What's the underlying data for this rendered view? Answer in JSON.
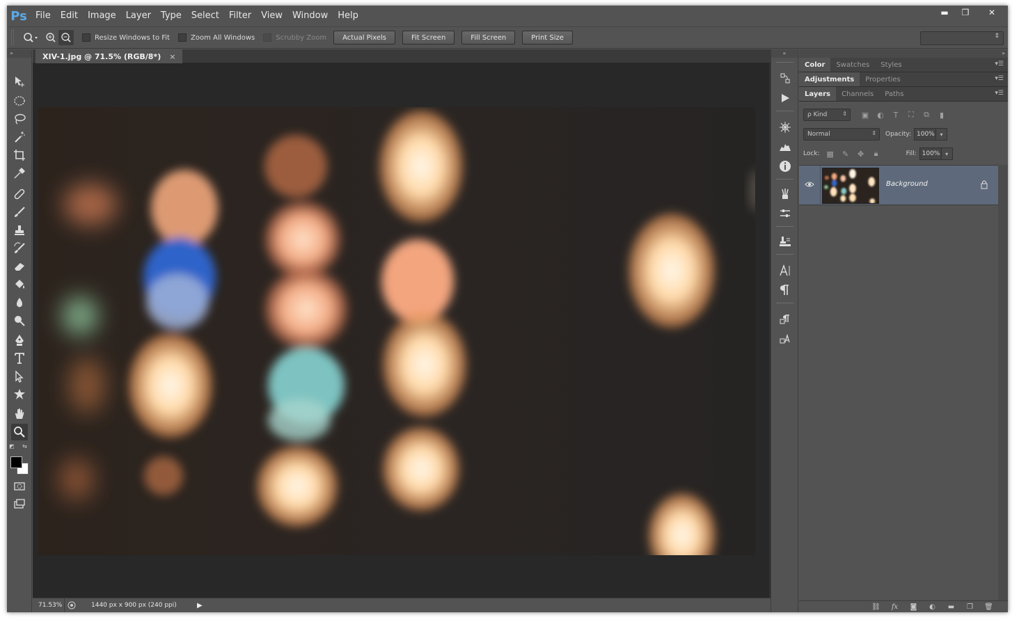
{
  "app": {
    "logo": "Ps",
    "menu": [
      "File",
      "Edit",
      "Image",
      "Layer",
      "Type",
      "Select",
      "Filter",
      "View",
      "Window",
      "Help"
    ],
    "window_controls": {
      "minimize": "▬",
      "restore": "❐",
      "close": "✕"
    }
  },
  "options_bar": {
    "tool_icon": "zoom-icon",
    "checkboxes": [
      {
        "label": "Resize Windows to Fit",
        "checked": false,
        "enabled": true
      },
      {
        "label": "Zoom All Windows",
        "checked": false,
        "enabled": true
      },
      {
        "label": "Scrubby Zoom",
        "checked": false,
        "enabled": false
      }
    ],
    "buttons": [
      "Actual Pixels",
      "Fit Screen",
      "Fill Screen",
      "Print Size"
    ],
    "workspace_arrow": "⇕"
  },
  "tools": [
    "move",
    "elliptical-marquee",
    "lasso",
    "magic-wand",
    "crop",
    "eyedropper",
    "spot-healing-brush",
    "brush",
    "clone-stamp",
    "history-brush",
    "eraser",
    "paint-bucket",
    "blur",
    "dodge",
    "pen",
    "type",
    "path-selection",
    "custom-shape",
    "hand",
    "zoom"
  ],
  "active_tool": "zoom",
  "document": {
    "tab_title": "XIV-1.jpg @ 71.5% (RGB/8*)",
    "close_glyph": "×",
    "zoom_readout": "71.53%",
    "doc_info": "1440 px x 900 px (240 ppi)",
    "status_arrow": "▶"
  },
  "dock_icons": [
    "history-icon",
    "play-actions-icon",
    "navigator-icon",
    "histogram-icon",
    "info-icon",
    "brush-presets-icon",
    "adjustments-dock-icon",
    "clone-source-icon",
    "character-icon",
    "paragraph-icon",
    "character-styles-icon",
    "paragraph-styles-icon"
  ],
  "panels": {
    "group1": {
      "tabs": [
        "Color",
        "Swatches",
        "Styles"
      ],
      "active": 0
    },
    "group2": {
      "tabs": [
        "Adjustments",
        "Properties"
      ],
      "active": 0
    },
    "group3": {
      "tabs": [
        "Layers",
        "Channels",
        "Paths"
      ],
      "active": 0
    },
    "menu_glyph": "▾☰",
    "layers": {
      "filter_kind": "ρ Kind",
      "blend_mode": "Normal",
      "opacity_label": "Opacity:",
      "opacity": "100%",
      "lock_label": "Lock:",
      "fill_label": "Fill:",
      "fill": "100%",
      "items": [
        {
          "name": "Background",
          "visible": true,
          "locked": true,
          "selected": true
        }
      ]
    }
  },
  "colors": {
    "chrome": "#535353",
    "canvas_bg": "#282828",
    "selected_layer": "#5e6a7b",
    "ps_blue": "#5ca9e6"
  }
}
